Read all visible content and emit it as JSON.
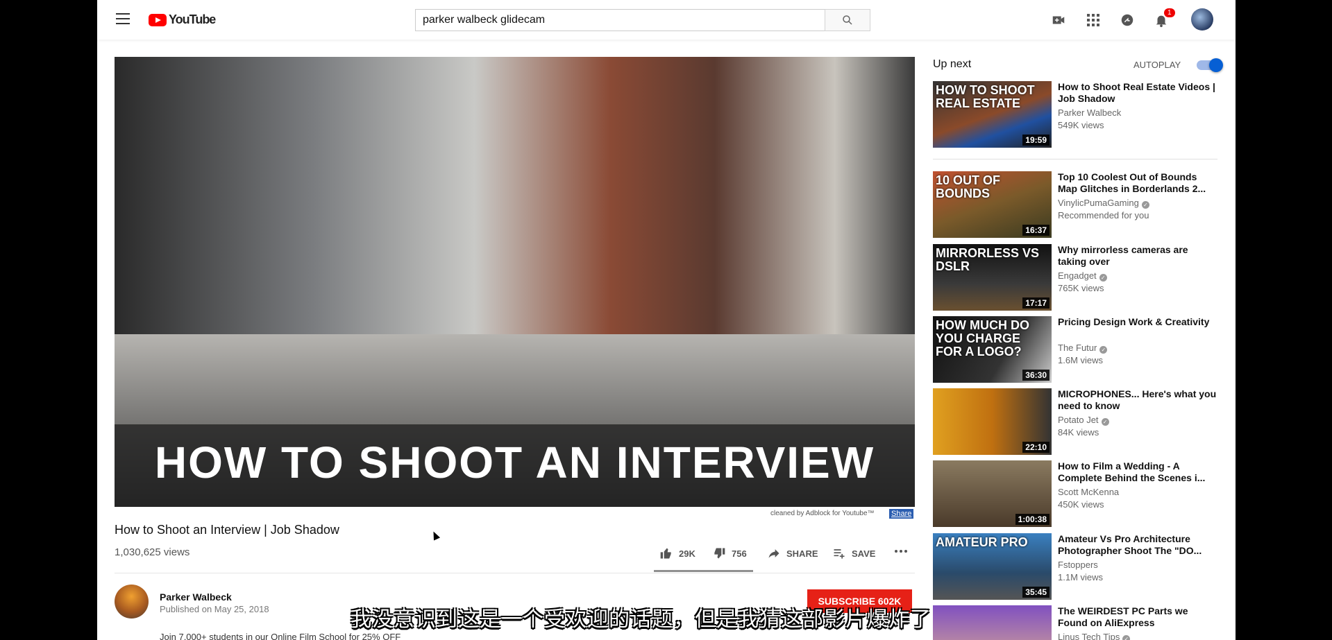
{
  "header": {
    "logo_text": "YouTube",
    "search_value": "parker walbeck glidecam",
    "notification_count": "1",
    "icons": [
      "menu-icon",
      "search-icon",
      "video-camera-icon",
      "apps-icon",
      "chat-icon",
      "bell-icon"
    ]
  },
  "video": {
    "caption_text": "HOW TO SHOOT AN INTERVIEW",
    "adblock_note": "cleaned by Adblock for Youtube™",
    "adblock_share": "Share",
    "title": "How to Shoot an Interview | Job Shadow",
    "views": "1,030,625 views",
    "likes": "29K",
    "dislikes": "756",
    "share_label": "SHARE",
    "save_label": "SAVE",
    "like_ratio": 0.97
  },
  "channel": {
    "name": "Parker Walbeck",
    "published": "Published on May 25, 2018",
    "subscribe_label": "SUBSCRIBE 602K",
    "description": "Join 7,000+ students in our Online Film School for 25% OFF"
  },
  "subtitle": "我没意识到这是一个受欢迎的话题，但是我猜这部影片爆炸了",
  "sidebar": {
    "up_next": "Up next",
    "autoplay_label": "AUTOPLAY",
    "autoplay_on": true,
    "accent": "#065fd4",
    "items": [
      {
        "title": "How to Shoot Real Estate Videos | Job Shadow",
        "channel": "Parker Walbeck",
        "meta": "549K views",
        "duration": "19:59",
        "thumb_text": "HOW TO SHOOT REAL ESTATE",
        "verified": false
      },
      {
        "title": "Top 10 Coolest Out of Bounds Map Glitches in Borderlands 2...",
        "channel": "VinylicPumaGaming",
        "meta": "Recommended for you",
        "duration": "16:37",
        "thumb_text": "10 OUT OF BOUNDS",
        "verified": true
      },
      {
        "title": "Why mirrorless cameras are taking over",
        "channel": "Engadget",
        "meta": "765K views",
        "duration": "17:17",
        "thumb_text": "MIRRORLESS VS DSLR",
        "verified": true
      },
      {
        "title": "Pricing Design Work & Creativity",
        "channel": "The Futur",
        "meta": "1.6M views",
        "duration": "36:30",
        "thumb_text": "HOW MUCH DO YOU CHARGE FOR A LOGO?",
        "verified": true
      },
      {
        "title": "MICROPHONES... Here's what you need to know",
        "channel": "Potato Jet",
        "meta": "84K views",
        "duration": "22:10",
        "thumb_text": "",
        "verified": true
      },
      {
        "title": "How to Film a Wedding - A Complete Behind the Scenes i...",
        "channel": "Scott McKenna",
        "meta": "450K views",
        "duration": "1:00:38",
        "thumb_text": "",
        "verified": false
      },
      {
        "title": "Amateur Vs Pro Architecture Photographer Shoot The \"DO...",
        "channel": "Fstoppers",
        "meta": "1.1M views",
        "duration": "35:45",
        "thumb_text": "AMATEUR PRO",
        "verified": false
      },
      {
        "title": "The WEIRDEST PC Parts we Found on AliExpress",
        "channel": "Linus Tech Tips",
        "meta": "",
        "duration": "",
        "thumb_text": "",
        "verified": true
      }
    ]
  }
}
